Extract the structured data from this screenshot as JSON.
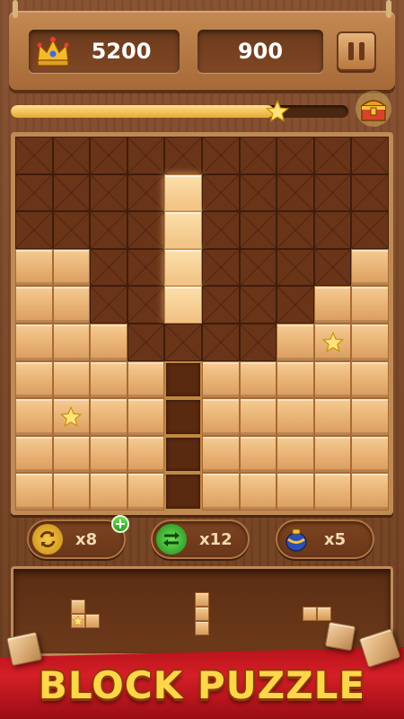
{
  "header": {
    "best_score": "5200",
    "current_score": "900",
    "best_icon": "crown-icon",
    "pause_icon": "pause-icon"
  },
  "progress": {
    "fraction": 0.78,
    "star_icon": "star-icon",
    "reward_icon": "treasure-chest-icon"
  },
  "board": {
    "cols": 10,
    "rows": 10,
    "cells": [
      "..........",
      "..........",
      "....g.....",
      "....g.....",
      "FF..g....F",
      "FF..g...FF",
      "FFF....FSF",
      "FFFFoFFFFF",
      "FSFFoFFFFF",
      "FFFFoFFFFF",
      "FFFFoFFFFF"
    ]
  },
  "powerups": [
    {
      "name": "refresh",
      "icon": "rotate-arrows-icon",
      "count": "x8",
      "has_add": true
    },
    {
      "name": "swap",
      "icon": "swap-arrows-icon",
      "count": "x12",
      "has_add": false
    },
    {
      "name": "bomb",
      "icon": "vase-bomb-icon",
      "count": "x5",
      "has_add": false
    }
  ],
  "banner": {
    "title": "BLOCK PUZZLE"
  },
  "colors": {
    "accent_gold": "#ffd64a",
    "banner_red": "#c8161d",
    "wood_light": "#e8b174",
    "wood_dark": "#6a3418"
  }
}
